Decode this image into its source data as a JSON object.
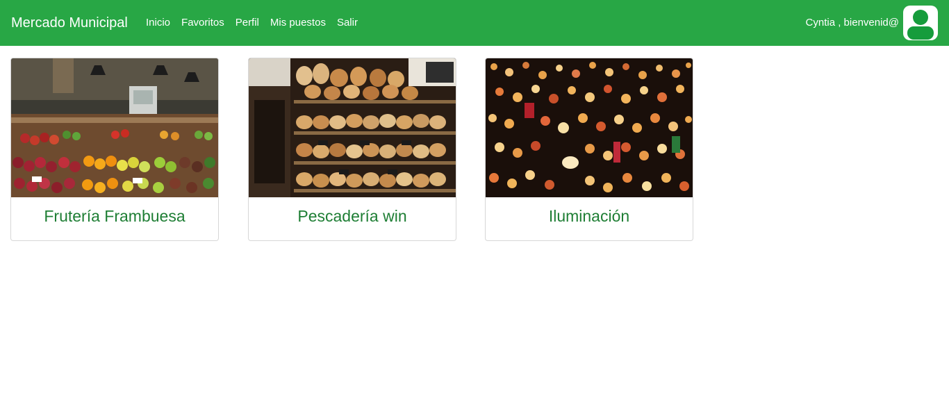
{
  "navbar": {
    "brand": "Mercado Municipal",
    "links": [
      {
        "label": "Inicio"
      },
      {
        "label": "Favoritos"
      },
      {
        "label": "Perfil"
      },
      {
        "label": "Mis puestos"
      },
      {
        "label": "Salir"
      }
    ],
    "greeting": "Cyntia , bienvenid@",
    "avatar_icon": "user-avatar-icon",
    "color": "#28a745"
  },
  "cards": [
    {
      "title": "Frutería Frambuesa",
      "image": "fruit-stall-photo"
    },
    {
      "title": "Pescadería win",
      "image": "bakery-bread-photo"
    },
    {
      "title": "Iluminación",
      "image": "hanging-lamps-photo"
    }
  ],
  "colors": {
    "accent": "#28a745",
    "title": "#1e7e34"
  }
}
